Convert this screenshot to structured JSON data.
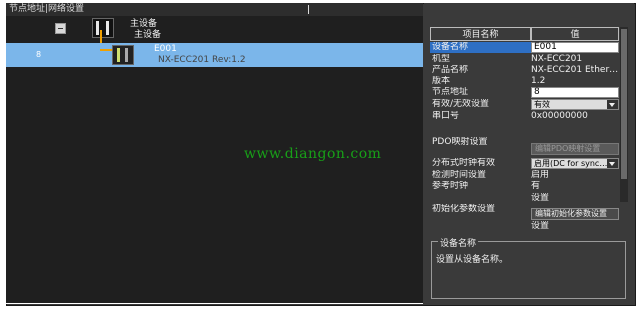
{
  "left_panel": {
    "title": "节点地址|网络设置",
    "master": {
      "label": "主设备",
      "sublabel": "主设备"
    },
    "slave": {
      "node_address": "8",
      "name": "E001",
      "model": "NX-ECC201 Rev:1.2"
    }
  },
  "watermark": "www.diangon.com",
  "properties": {
    "header": {
      "name": "项目名称",
      "value": "值"
    },
    "rows": [
      {
        "key": "设备名称",
        "value": "E001"
      },
      {
        "key": "机型",
        "value": "NX-ECC201"
      },
      {
        "key": "产品名称",
        "value": "NX-ECC201 Ether…"
      },
      {
        "key": "版本",
        "value": "1.2"
      },
      {
        "key": "节点地址",
        "value": "8"
      },
      {
        "key": "有效/无效设置",
        "value": "有效"
      },
      {
        "key": "串口号",
        "value": "0x00000000"
      },
      {
        "key": "PDO映射设置",
        "value": "编辑PDO映射设置"
      },
      {
        "key": "分布式时钟有效",
        "value": "启用(DC for sync…"
      },
      {
        "key": "检测时间设置",
        "value": "启用"
      },
      {
        "key": "参考时钟",
        "value": "有"
      },
      {
        "key": "初始化参数设置",
        "value_top": "设置",
        "value": "编辑初始化参数设置",
        "value_bottom": "设置"
      }
    ]
  },
  "description": {
    "title": "设备名称",
    "text": "设置从设备名称。"
  },
  "colors": {
    "selection": "#7bb6ea",
    "connector": "#f0a000",
    "watermark": "#18a018"
  }
}
